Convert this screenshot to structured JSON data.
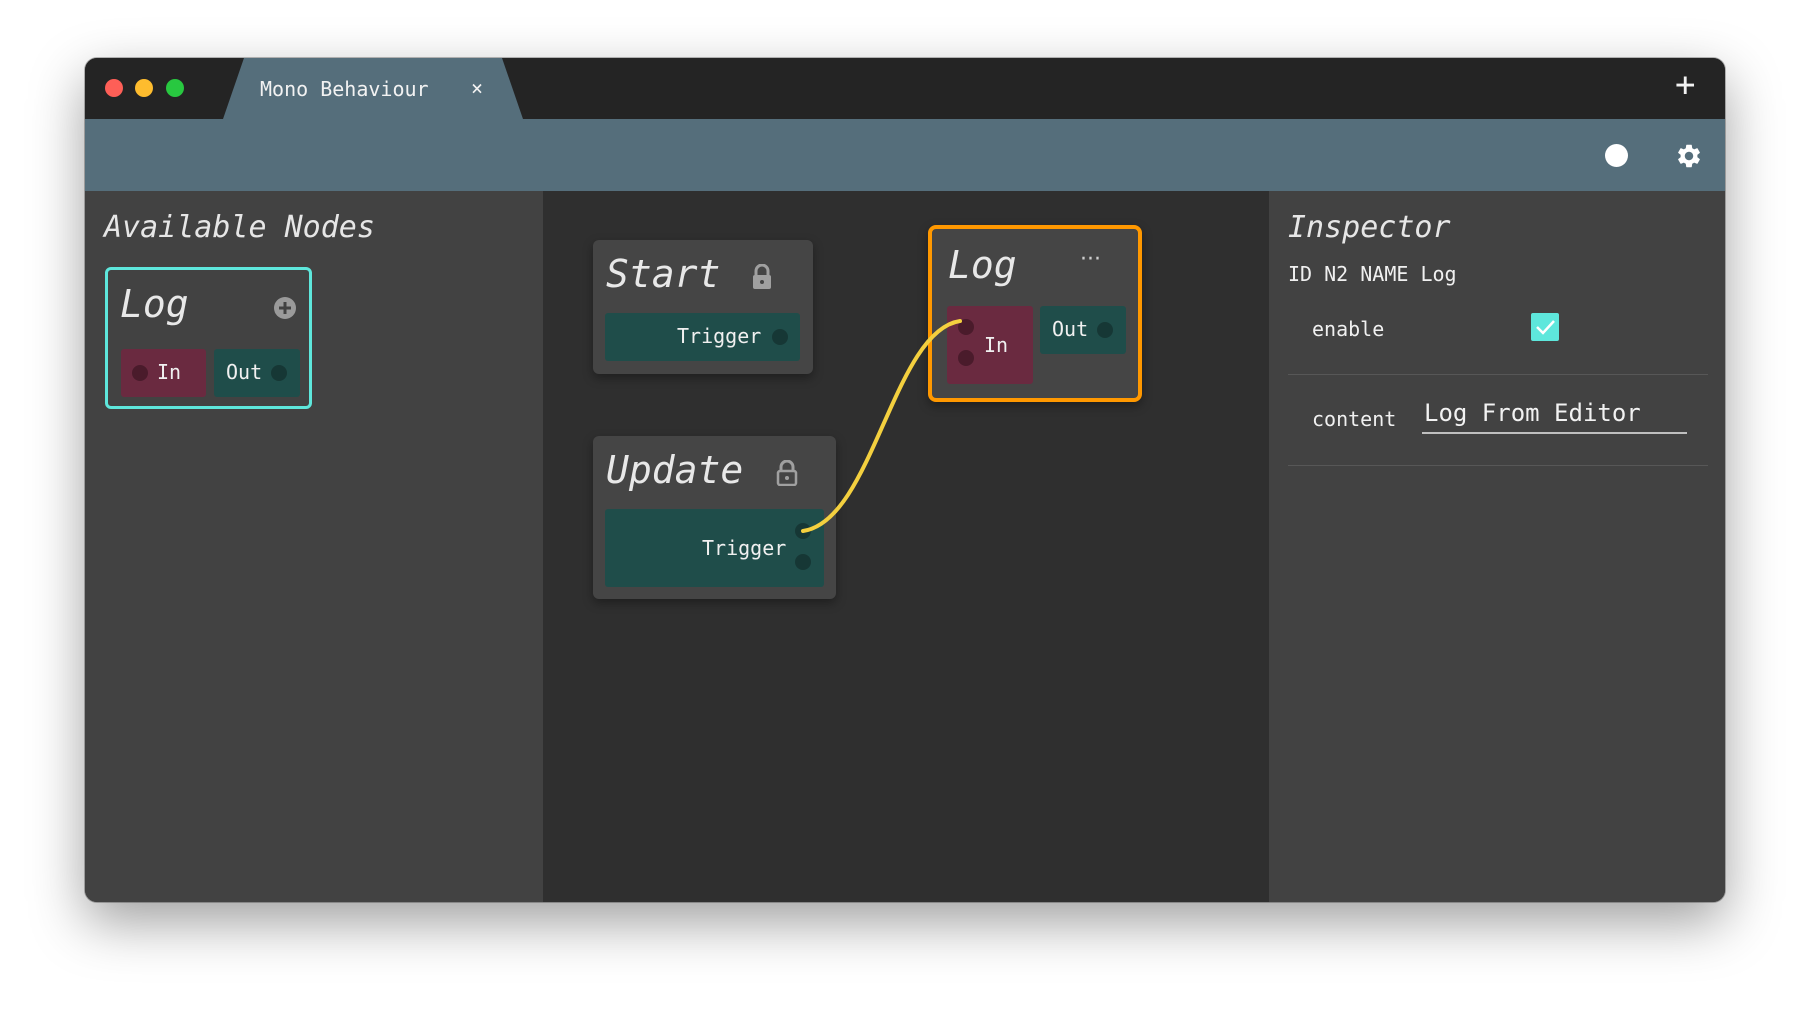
{
  "window": {
    "tab_label": "Mono Behaviour",
    "tab_close": "×",
    "new_tab": "+"
  },
  "palette": {
    "title": "Available Nodes",
    "nodes": [
      {
        "title": "Log",
        "in_label": "In",
        "out_label": "Out",
        "icon": "add-circle-icon"
      }
    ]
  },
  "graph": {
    "nodes": [
      {
        "id": "start",
        "title": "Start",
        "port_label": "Trigger",
        "icon": "lock-closed-icon"
      },
      {
        "id": "update",
        "title": "Update",
        "port_label": "Trigger",
        "icon": "lock-open-icon"
      },
      {
        "id": "log",
        "title": "Log",
        "in_label": "In",
        "out_label": "Out",
        "menu": "···",
        "selected": true
      }
    ],
    "connection": {
      "from": "update.Trigger",
      "to": "log.In",
      "color": "#f4d03f"
    }
  },
  "inspector": {
    "title": "Inspector",
    "meta": "ID N2 NAME Log",
    "fields": {
      "enable": {
        "label": "enable",
        "checked": true
      },
      "content": {
        "label": "content",
        "value": "Log From Editor"
      }
    }
  },
  "colors": {
    "toolbar": "#556e7b",
    "palette_highlight": "#5ee7dc",
    "selection": "#ff9800",
    "port_in": "#6a2a40",
    "port_out": "#1f4d4a"
  }
}
